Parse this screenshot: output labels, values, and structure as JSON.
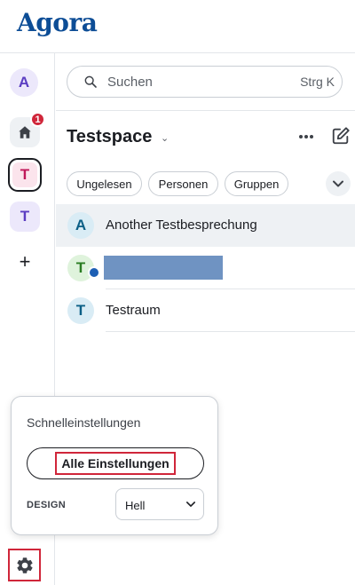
{
  "app": {
    "logo": "Agora"
  },
  "rail": {
    "user_avatar_initial": "A",
    "home_badge_count": "1",
    "spaces": [
      {
        "initial": "T",
        "selected": true,
        "color": "#c0185a"
      },
      {
        "initial": "T",
        "selected": false,
        "color": "#5b3dc2"
      }
    ],
    "add_space_glyph": "+",
    "settings_icon": "gear-icon"
  },
  "search": {
    "placeholder": "Suchen",
    "shortcut": "Strg K"
  },
  "space_header": {
    "title": "Testspace",
    "caret": "⌄"
  },
  "filters": [
    "Ungelesen",
    "Personen",
    "Gruppen"
  ],
  "rooms": [
    {
      "initial": "A",
      "name": "Another Testbesprechung",
      "active": true
    },
    {
      "initial": "T",
      "name": "",
      "redacted": true,
      "public_icon": "globe-icon"
    },
    {
      "initial": "T",
      "name": "Testraum",
      "active": false
    }
  ],
  "quick_settings": {
    "title": "Schnelleinstellungen",
    "all_settings_label": "Alle Einstellungen",
    "design_label": "DESIGN",
    "design_value": "Hell"
  },
  "colors": {
    "brand": "#0d4d96",
    "accent_red": "#d0263a",
    "redaction": "#6f93c2"
  }
}
